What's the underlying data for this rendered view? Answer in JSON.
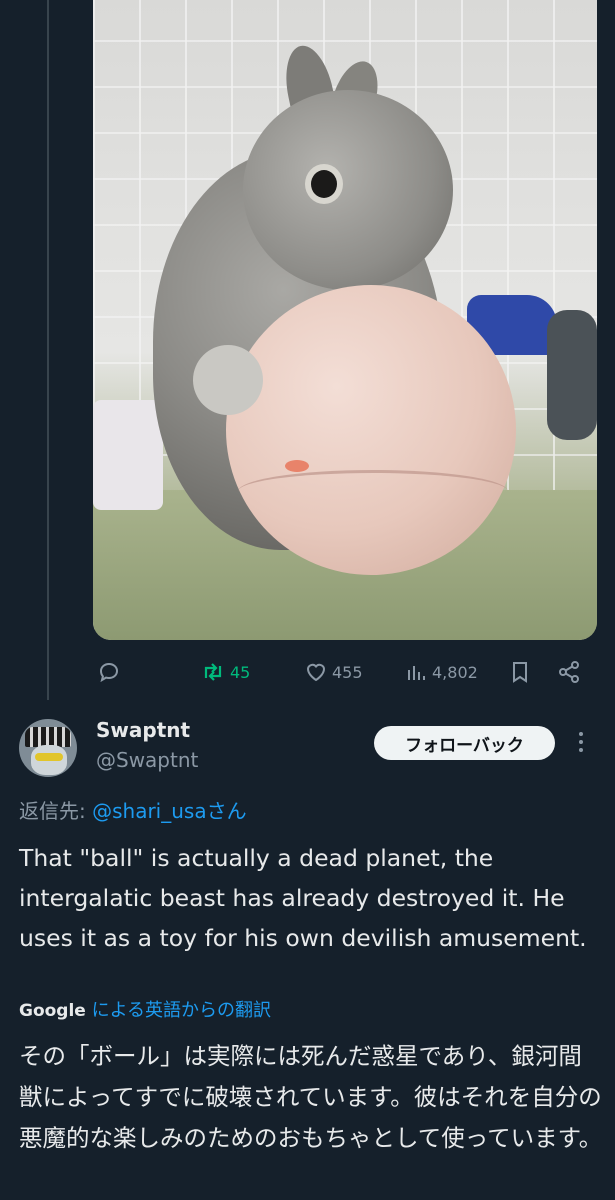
{
  "post": {
    "actions": {
      "reply_count": "",
      "retweet_count": "45",
      "like_count": "455",
      "view_count": "4,802"
    }
  },
  "reply": {
    "display_name": "Swaptnt",
    "handle": "@Swaptnt",
    "follow_back_label": "フォローバック",
    "replying_prefix": "返信先: ",
    "replying_mention": "@shari_usaさん",
    "text": "That \"ball\" is actually a dead planet, the intergalatic beast has already destroyed it. He uses it as a toy for his own devilish amusement.",
    "translation_source": "Google",
    "translation_link": "による英語からの翻訳",
    "translated_text": "その「ボール」は実際には死んだ惑星であり、銀河間獣によってすでに破壊されています。彼はそれを自分の悪魔的な楽しみのためのおもちゃとして使っています。"
  },
  "colors": {
    "background": "#15202b",
    "text_primary": "#e7e9ea",
    "text_secondary": "#8b98a5",
    "link": "#1d9bf0",
    "retweet_active": "#00ba7c"
  }
}
